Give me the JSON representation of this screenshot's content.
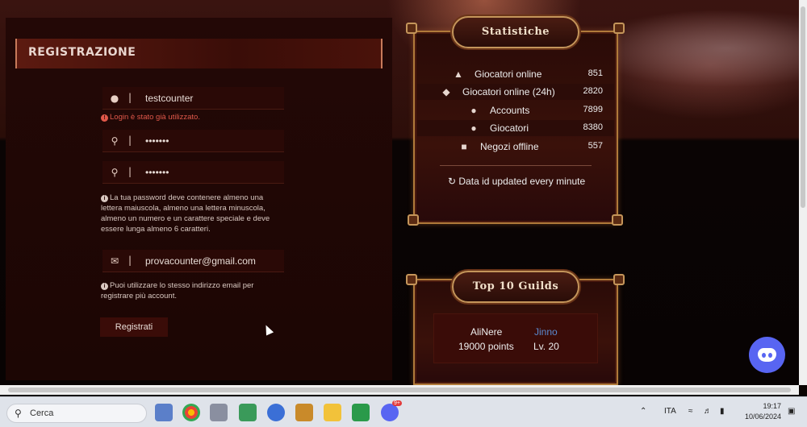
{
  "registration": {
    "title": "REGISTRAZIONE",
    "username_value": "testcounter",
    "username_error": "Login è stato già utilizzato.",
    "password_value": "•••••••",
    "confirm_value": "•••••••",
    "password_info": "La tua password deve contenere almeno una lettera maiuscola, almeno una lettera minuscola, almeno un numero e un carattere speciale e deve essere lunga almeno 6 caratteri.",
    "email_value": "provacounter@gmail.com",
    "email_info": "Puoi utilizzare lo stesso indirizzo email per registrare più account.",
    "submit_label": "Registrati",
    "separator": "|"
  },
  "stats": {
    "title": "Statistiche",
    "rows": [
      {
        "label": "Giocatori online",
        "value": "851",
        "icon": "armor-icon"
      },
      {
        "label": "Giocatori online (24h)",
        "value": "2820",
        "icon": "shield-icon"
      },
      {
        "label": "Accounts",
        "value": "7899",
        "icon": "users-icon"
      },
      {
        "label": "Giocatori",
        "value": "8380",
        "icon": "users-icon"
      },
      {
        "label": "Negozi offline",
        "value": "557",
        "icon": "shop-icon"
      }
    ],
    "updated": "Data id updated every minute"
  },
  "guilds": {
    "title": "Top 10 Guilds",
    "top": {
      "name": "AliNere",
      "leader": "Jinno",
      "points": "19000 points",
      "level": "Lv. 20"
    }
  },
  "taskbar": {
    "search_placeholder": "Cerca",
    "language": "ITA",
    "time": "19:17",
    "date": "10/06/2024",
    "discord_badge": "9+"
  },
  "colors": {
    "accent": "#c4955a",
    "error": "#e0584a",
    "discord": "#5865f2",
    "link": "#5a8ad0"
  }
}
